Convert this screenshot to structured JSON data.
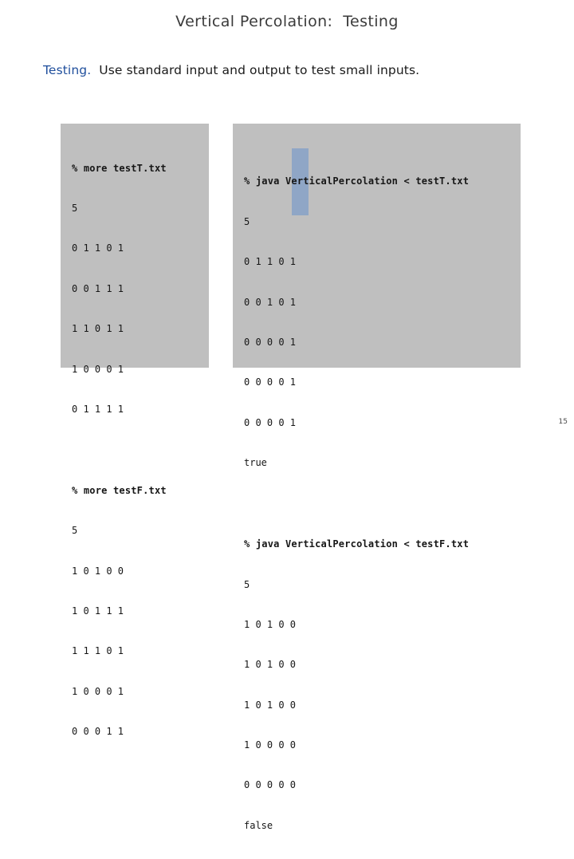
{
  "slide": {
    "title": "Vertical Percolation:  Testing",
    "page_number": "15",
    "panel_bg": "#bfbfbf",
    "highlight_color": "#8fa6c6",
    "accent_color": "#1f4e9c"
  },
  "subtitle": {
    "lead": "Testing.",
    "rest": "  Use standard input and output to test small inputs."
  },
  "terminals": {
    "left": [
      {
        "name": "more-testT",
        "command": "% more testT.txt",
        "lines": [
          "5",
          "0 1 1 0 1",
          "0 0 1 1 1",
          "1 1 0 1 1",
          "1 0 0 0 1",
          "0 1 1 1 1"
        ]
      },
      {
        "name": "more-testF",
        "command": "% more testF.txt",
        "lines": [
          "5",
          "1 0 1 0 0",
          "1 0 1 1 1",
          "1 1 1 0 1",
          "1 0 0 0 1",
          "0 0 0 1 1"
        ]
      }
    ],
    "right": [
      {
        "name": "java-testT",
        "command": "% java VerticalPercolation < testT.txt",
        "lines": [
          "5",
          "0 1 1 0 1",
          "0 0 1 0 1",
          "0 0 0 0 1",
          "0 0 0 0 1",
          "0 0 0 0 1",
          "true"
        ],
        "highlight": {
          "column": 5,
          "first_row_index": 1,
          "row_count": 5
        }
      },
      {
        "name": "java-testF",
        "command": "% java VerticalPercolation < testF.txt",
        "lines": [
          "5",
          "1 0 1 0 0",
          "1 0 1 0 0",
          "1 0 1 0 0",
          "1 0 0 0 0",
          "0 0 0 0 0",
          "false"
        ],
        "highlight": null
      }
    ]
  }
}
